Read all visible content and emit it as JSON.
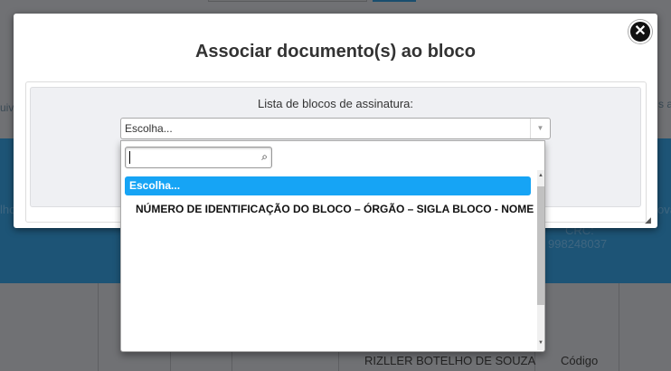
{
  "background": {
    "left_text_1": "uivo",
    "left_text_2": "lho",
    "right_text_1": "s a",
    "right_text_2": "ova",
    "crc_label": "CRC:",
    "crc_value": "998248037",
    "name": "RIZLLER BOTELHO DE SOUZA",
    "codigo": "Código"
  },
  "modal": {
    "title": "Associar documento(s) ao bloco",
    "close_icon": "close-circle-icon",
    "field_label": "Lista de blocos de assinatura:",
    "select_value": "Escolha...",
    "search": {
      "value": "",
      "icon": "search-icon"
    },
    "options": [
      {
        "label": "Escolha...",
        "selected": true
      },
      {
        "label": "NÚMERO DE IDENTIFICAÇÃO DO BLOCO – ÓRGÃO – SIGLA BLOCO - NOME",
        "selected": false
      }
    ]
  },
  "colors": {
    "highlight": "#16a4f5",
    "band": "#1d5476",
    "overlay": "#707174"
  }
}
